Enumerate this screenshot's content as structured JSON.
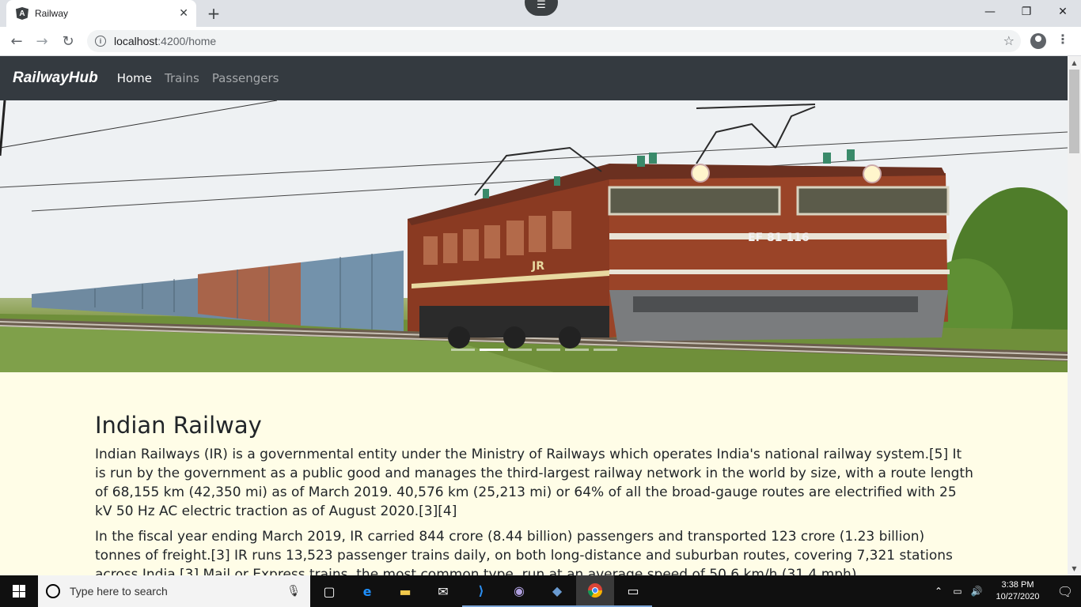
{
  "browser": {
    "tab_title": "Railway",
    "tab_favicon": "angular-icon",
    "url_host": "localhost",
    "url_path": ":4200/home",
    "new_tab_label": "+",
    "close_tab_label": "✕",
    "window": {
      "minimize": "—",
      "maximize": "❐",
      "close": "✕"
    }
  },
  "navbar": {
    "brand": "RailwayHub",
    "links": [
      {
        "label": "Home",
        "active": true
      },
      {
        "label": "Trains",
        "active": false
      },
      {
        "label": "Passengers",
        "active": false
      }
    ],
    "bg_color": "#343a40"
  },
  "carousel": {
    "slide_count": 6,
    "active_index": 1,
    "locomotive_plate": "EF 81 116",
    "logo_mark": "JR"
  },
  "content": {
    "heading": "Indian Railway",
    "paragraphs": [
      "Indian Railways (IR) is a governmental entity under the Ministry of Railways which operates India's national railway system.[5] It is run by the government as a public good and manages the third-largest railway network in the world by size, with a route length of 68,155 km (42,350 mi) as of March 2019. 40,576 km (25,213 mi) or 64% of all the broad-gauge routes are electrified with 25 kV 50 Hz AC electric traction as of August 2020.[3][4]",
      "In the fiscal year ending March 2019, IR carried 844 crore (8.44 billion) passengers and transported 123 crore (1.23 billion) tonnes of freight.[3] IR runs 13,523 passenger trains daily, on both long-distance and suburban routes, covering 7,321 stations across India.[3] Mail or Express trains, the most common type, run at an average speed of 50.6 km/h (31.4 mph)."
    ],
    "bg_color": "#fffde7"
  },
  "taskbar": {
    "search_placeholder": "Type here to search",
    "time": "3:38 PM",
    "date": "10/27/2020",
    "apps": [
      "task-view-icon",
      "edge-icon",
      "file-explorer-icon",
      "mail-icon",
      "vscode-icon",
      "eclipse-icon",
      "mysql-workbench-icon",
      "chrome-icon",
      "terminal-icon"
    ]
  }
}
